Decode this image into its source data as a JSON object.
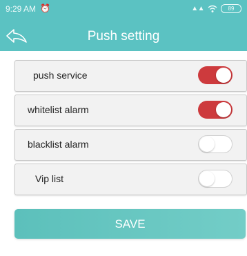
{
  "status_bar": {
    "time": "9:29 AM",
    "alarm_icon": "alarm-clock-icon",
    "network": "ᵢₗ",
    "battery": "89"
  },
  "header": {
    "title": "Push setting",
    "back_icon": "back-arrow-icon",
    "color": "#5bc2c2"
  },
  "settings": [
    {
      "label": "push service",
      "enabled": true
    },
    {
      "label": "whitelist alarm",
      "enabled": true
    },
    {
      "label": "blacklist alarm",
      "enabled": false
    },
    {
      "label": "Vip list",
      "enabled": false
    }
  ],
  "save_button": {
    "label": "SAVE"
  },
  "colors": {
    "toggle_on": "#cd3a3d",
    "accent": "#5bc2c2"
  }
}
